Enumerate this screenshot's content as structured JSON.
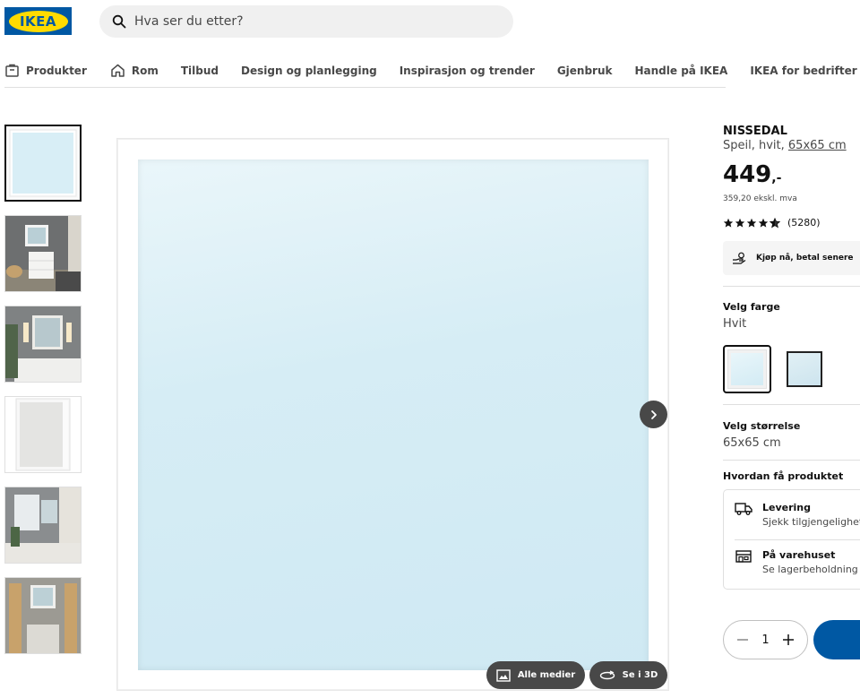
{
  "header": {
    "logo_text": "IKEA",
    "search_placeholder": "Hva ser du etter?"
  },
  "nav": {
    "items": [
      {
        "label": "Produkter",
        "icon": "products-icon"
      },
      {
        "label": "Rom",
        "icon": "home-icon"
      },
      {
        "label": "Tilbud"
      },
      {
        "label": "Design og planlegging"
      },
      {
        "label": "Inspirasjon og trender"
      },
      {
        "label": "Gjenbruk"
      },
      {
        "label": "Handle på IKEA"
      },
      {
        "label": "IKEA for bedrifter"
      }
    ]
  },
  "gallery": {
    "thumbnail_count": 6,
    "all_media_label": "Alle medier",
    "view_3d_label": "Se i 3D"
  },
  "product": {
    "name": "NISSEDAL",
    "desc_prefix": "Speil, hvit, ",
    "size_link": "65x65 cm",
    "price": "449",
    "price_suffix": ",-",
    "price_ex_vat": "359,20 ekskl. mva",
    "rating_stars": 4.5,
    "review_count": "(5280)",
    "buy_now_label": "Kjøp nå, betal senere"
  },
  "color": {
    "title": "Velg farge",
    "value": "Hvit"
  },
  "size": {
    "title": "Velg størrelse",
    "value": "65x65 cm"
  },
  "delivery": {
    "title": "Hvordan få produktet",
    "options": [
      {
        "title": "Levering",
        "sub": "Sjekk tilgjengelighet"
      },
      {
        "title": "På varehuset",
        "sub": "Se lagerbeholdning på"
      }
    ]
  },
  "quantity": {
    "value": "1"
  },
  "colors": {
    "ikea_blue": "#0058a3",
    "ikea_yellow": "#ffdb00",
    "dark_button": "#484848"
  }
}
